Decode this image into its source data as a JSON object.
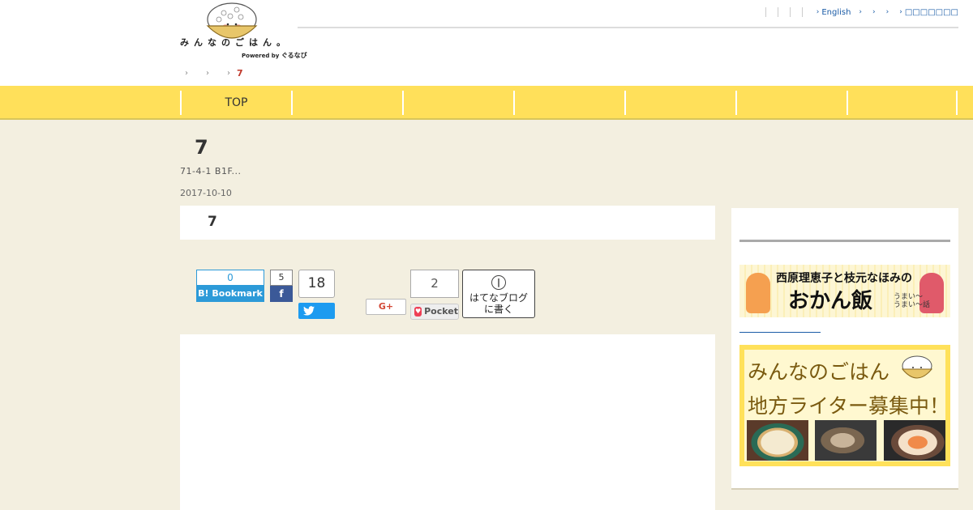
{
  "logo": {
    "text": "みんなのごはん。",
    "powered_prefix": "Powered by",
    "powered_brand": "ぐるなび"
  },
  "topnav": {
    "language": "English",
    "last_link": "□□□□□□□"
  },
  "breadcrumb": {
    "current": "7"
  },
  "gnav": {
    "items": [
      "TOP",
      "",
      "",
      "",
      "",
      "",
      ""
    ]
  },
  "article": {
    "title": "7",
    "address": "71-4-1  B1F...",
    "date": "2017-10-10",
    "box_title": "7"
  },
  "share": {
    "hatena_count": "0",
    "hatena_label": "B! Bookmark",
    "facebook_count": "5",
    "facebook_label": "f",
    "twitter_count": "18",
    "gplus_label": "G+",
    "pocket_count": "2",
    "pocket_label": "Pocket",
    "hatena_blog_line1": "はてなブログ",
    "hatena_blog_line2": "に書く"
  },
  "sidebar": {
    "banner1_title": "西原理恵子と枝元なほみの",
    "banner1_main": "おかん飯",
    "banner1_sub1": "うまい～",
    "banner1_sub2": "うまい～話",
    "banner2_line1": "みんなのごはん",
    "banner2_line2": "地方ライター募集中！"
  },
  "colors": {
    "nav_yellow": "#ffe05a",
    "page_bg": "#f3efe0",
    "link_blue": "#1a5ba6",
    "accent_red": "#c0392b"
  }
}
